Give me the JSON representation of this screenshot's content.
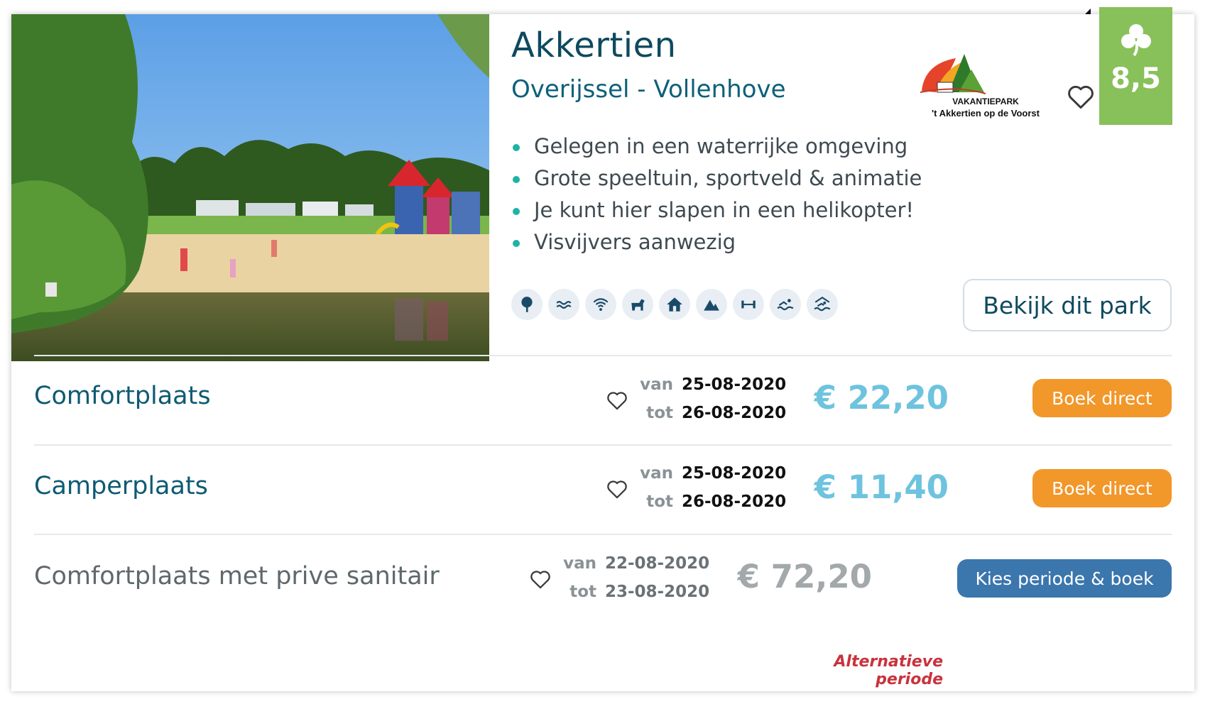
{
  "park": {
    "name": "Akkertien",
    "region": "Overijssel - Vollenhove",
    "logo_line1": "VAKANTIEPARK",
    "logo_line2": "'t Akkertien op de Voorst",
    "rating": "8,5",
    "usps": [
      "Gelegen in een waterrijke omgeving",
      "Grote speeltuin, sportveld & animatie",
      "Je kunt hier slapen in een helikopter!",
      "Visvijvers aanwezig"
    ],
    "facilities": [
      "tree-icon",
      "water-icon",
      "wifi-icon",
      "dog-icon",
      "house-icon",
      "tent-icon",
      "fitness-icon",
      "swimming-icon",
      "swimming-pool-icon"
    ],
    "view_button": "Bekijk dit park"
  },
  "offers": [
    {
      "name": "Comfortplaats",
      "from_label": "van",
      "from_date": "25-08-2020",
      "to_label": "tot",
      "to_date": "26-08-2020",
      "price": "€ 22,20",
      "button": "Boek direct"
    },
    {
      "name": "Camperplaats",
      "from_label": "van",
      "from_date": "25-08-2020",
      "to_label": "tot",
      "to_date": "26-08-2020",
      "price": "€ 11,40",
      "button": "Boek direct"
    },
    {
      "name": "Comfortplaats met prive sanitair",
      "from_label": "van",
      "from_date": "22-08-2020",
      "to_label": "tot",
      "to_date": "23-08-2020",
      "price": "€ 72,20",
      "button": "Kies periode & boek",
      "note": "Alternatieve periode"
    }
  ],
  "colors": {
    "rating_bg": "#88c05a",
    "book_orange": "#f2972a",
    "book_blue": "#3b76ad",
    "price_teal": "#6ec3de",
    "alt_red": "#c9323d",
    "bullet": "#1eb3a4"
  }
}
